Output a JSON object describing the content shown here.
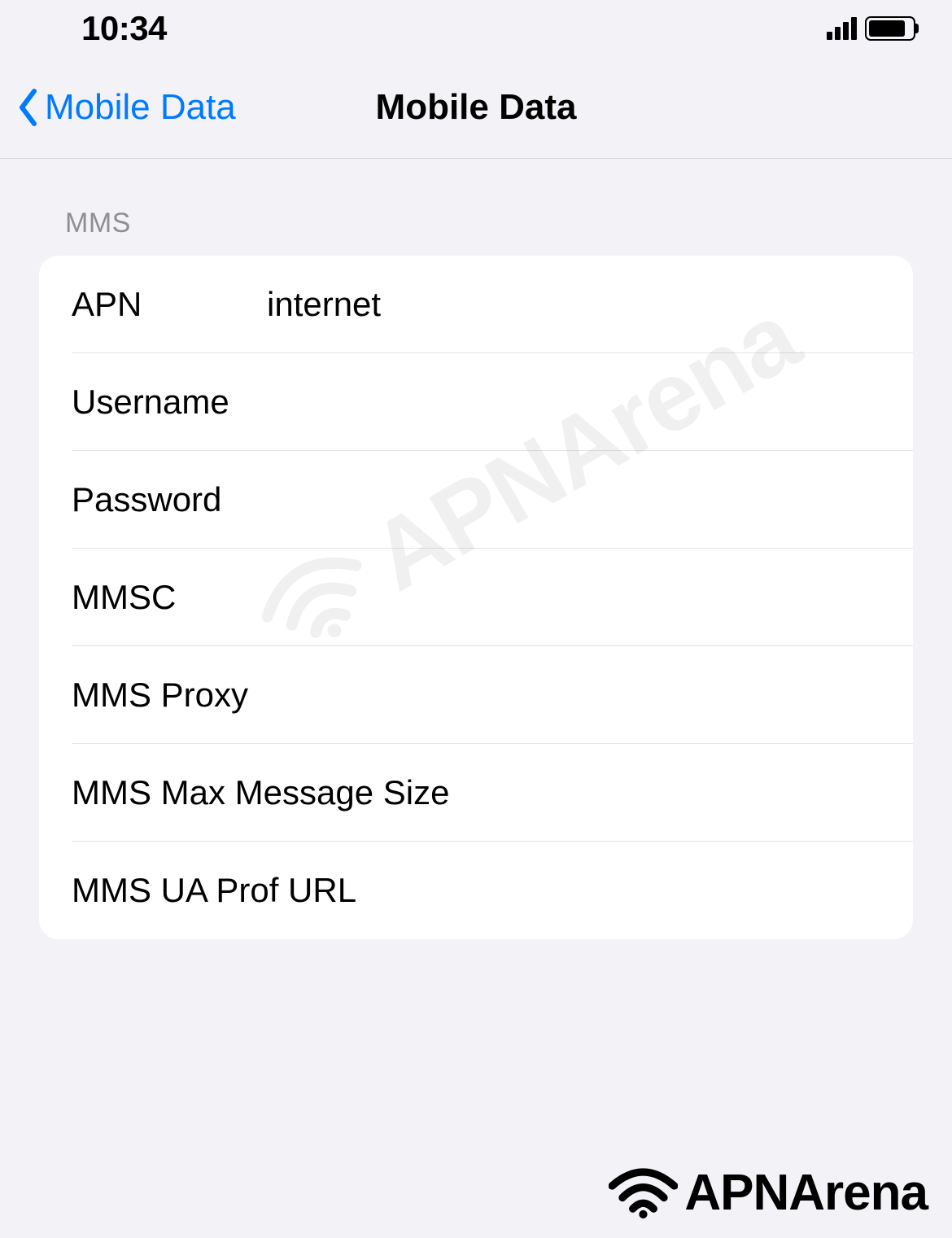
{
  "status_bar": {
    "time": "10:34"
  },
  "nav": {
    "back_label": "Mobile Data",
    "title": "Mobile Data"
  },
  "section": {
    "header": "MMS",
    "rows": [
      {
        "label": "APN",
        "value": "internet",
        "wide": false
      },
      {
        "label": "Username",
        "value": "",
        "wide": false
      },
      {
        "label": "Password",
        "value": "",
        "wide": false
      },
      {
        "label": "MMSC",
        "value": "",
        "wide": false
      },
      {
        "label": "MMS Proxy",
        "value": "",
        "wide": false
      },
      {
        "label": "MMS Max Message Size",
        "value": "",
        "wide": true
      },
      {
        "label": "MMS UA Prof URL",
        "value": "",
        "wide": true
      }
    ]
  },
  "watermark": "APNArena",
  "brand": "APNArena"
}
